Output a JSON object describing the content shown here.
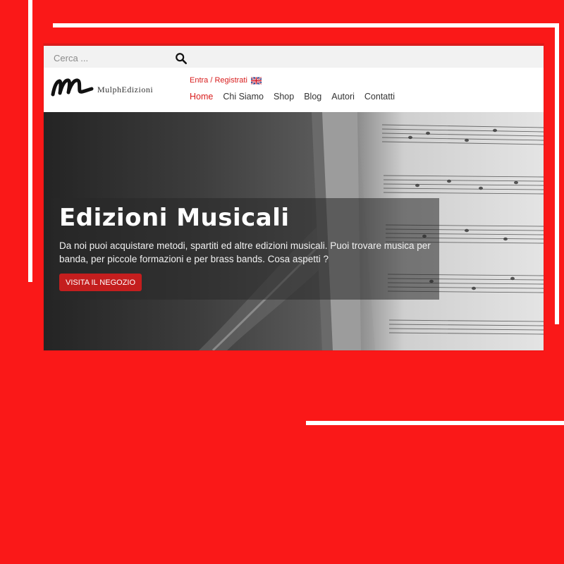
{
  "colors": {
    "background": "#fa1818",
    "accent": "#d81c1c",
    "button": "#c41e1e"
  },
  "search": {
    "placeholder": "Cerca ...",
    "icon": "search-icon"
  },
  "header": {
    "logo_text": "MulphEdizioni",
    "login_label": "Entra / Registrati",
    "language_icon": "uk-flag-icon"
  },
  "nav": {
    "items": [
      {
        "label": "Home",
        "active": true
      },
      {
        "label": "Chi Siamo"
      },
      {
        "label": "Shop"
      },
      {
        "label": "Blog"
      },
      {
        "label": "Autori"
      },
      {
        "label": "Contatti"
      }
    ]
  },
  "hero": {
    "title": "Edizioni Musicali",
    "text_line1": "Da noi puoi acquistare metodi, spartiti ed altre edizioni musicali. Puoi trovare musica per",
    "text_line2": "banda, per piccole formazioni e per brass bands. Cosa aspetti ?",
    "button_label": "VISITA IL NEGOZIO"
  }
}
